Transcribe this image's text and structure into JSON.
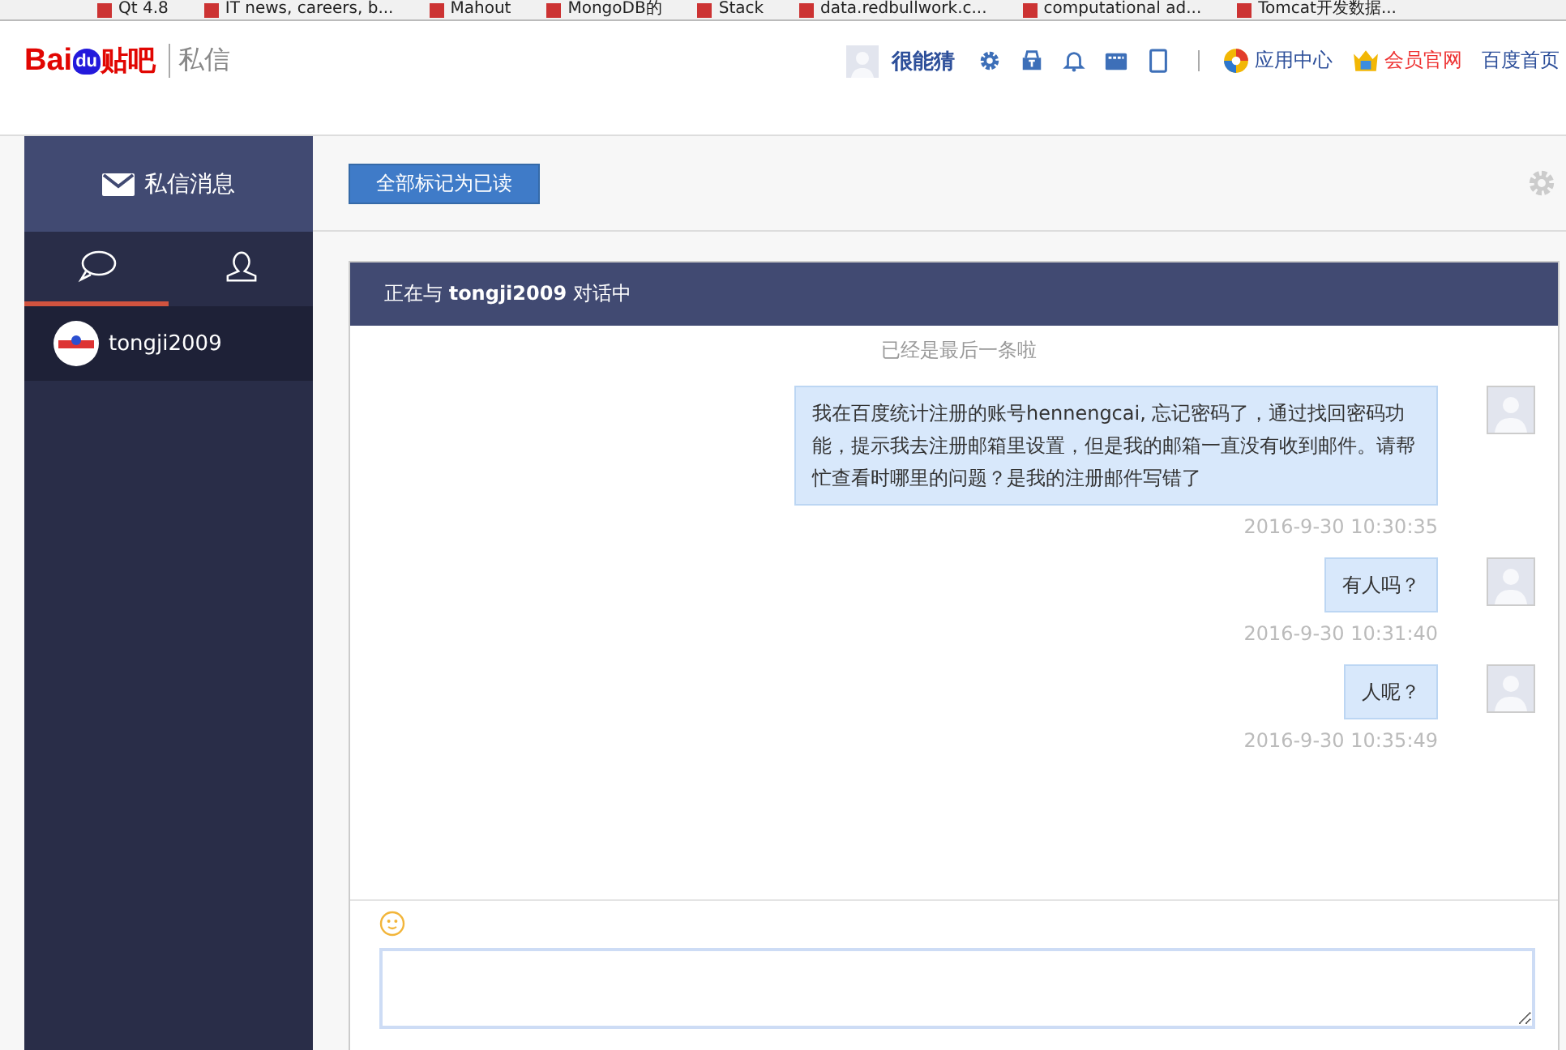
{
  "bookmarks": [
    "Qt 4.8",
    "IT news, careers, b...",
    "Mahout",
    "MongoDB的",
    "Stack",
    "data.redbullwork.c...",
    "computational ad...",
    "Tomcat开发数据..."
  ],
  "header": {
    "logo": {
      "bai": "Bai",
      "du": "du",
      "tieba": "贴吧"
    },
    "section": "私信",
    "username": "很能猜",
    "links": [
      {
        "label": "应用中心",
        "kind": "app"
      },
      {
        "label": "会员官网",
        "kind": "vip"
      },
      {
        "label": "百度首页",
        "kind": "plain"
      }
    ]
  },
  "sidebar": {
    "title": "私信消息",
    "tabs": [
      {
        "kind": "chat",
        "selected": true
      },
      {
        "kind": "contacts",
        "selected": false
      }
    ],
    "conversations": [
      {
        "name": "tongji2009",
        "selected": true
      }
    ]
  },
  "toolbar": {
    "mark_all_read": "全部标记为已读"
  },
  "chat": {
    "title_prefix": "正在与",
    "partner": "tongji2009",
    "title_suffix": "对话中",
    "notice": "已经是最后一条啦",
    "messages": [
      {
        "text": "我在百度统计注册的账号hennengcai, 忘记密码了，通过找回密码功能，提示我去注册邮箱里设置，但是我的邮箱一直没有收到邮件。请帮忙查看时哪里的问题？是我的注册邮件写错了",
        "time": "2016-9-30 10:30:35"
      },
      {
        "text": "有人吗？",
        "time": "2016-9-30 10:31:40"
      },
      {
        "text": "人呢？",
        "time": "2016-9-30 10:35:49"
      }
    ]
  }
}
